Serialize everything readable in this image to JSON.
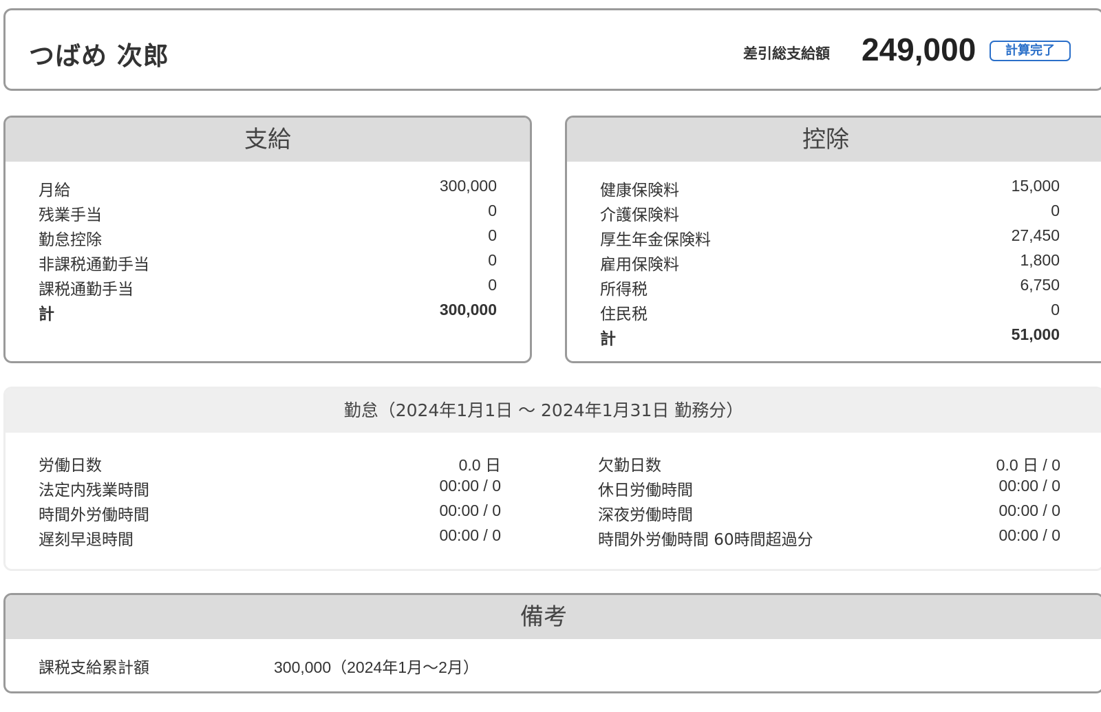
{
  "header": {
    "employee_name": "つばめ 次郎",
    "net_pay_label": "差引総支給額",
    "net_pay_amount": "249,000",
    "status_badge": "計算完了"
  },
  "payments": {
    "title": "支給",
    "items": [
      {
        "label": "月給",
        "value": "300,000"
      },
      {
        "label": "残業手当",
        "value": "0"
      },
      {
        "label": "勤怠控除",
        "value": "0"
      },
      {
        "label": "非課税通勤手当",
        "value": "0"
      },
      {
        "label": "課税通勤手当",
        "value": "0"
      }
    ],
    "total_label": "計",
    "total_value": "300,000"
  },
  "deductions": {
    "title": "控除",
    "items": [
      {
        "label": "健康保険料",
        "value": "15,000"
      },
      {
        "label": "介護保険料",
        "value": "0"
      },
      {
        "label": "厚生年金保険料",
        "value": "27,450"
      },
      {
        "label": "雇用保険料",
        "value": "1,800"
      },
      {
        "label": "所得税",
        "value": "6,750"
      },
      {
        "label": "住民税",
        "value": "0"
      }
    ],
    "total_label": "計",
    "total_value": "51,000"
  },
  "attendance": {
    "title": "勤怠（2024年1月1日 〜 2024年1月31日 勤務分）",
    "left": [
      {
        "label": "労働日数",
        "value": "0.0 日"
      },
      {
        "label": "法定内残業時間",
        "value": "00:00 / 0"
      },
      {
        "label": "時間外労働時間",
        "value": "00:00 / 0"
      },
      {
        "label": "遅刻早退時間",
        "value": "00:00 / 0"
      }
    ],
    "right": [
      {
        "label": "欠勤日数",
        "value": "0.0 日 / 0"
      },
      {
        "label": "休日労働時間",
        "value": "00:00 / 0"
      },
      {
        "label": "深夜労働時間",
        "value": "00:00 / 0"
      },
      {
        "label": "時間外労働時間 60時間超過分",
        "value": "00:00 / 0"
      }
    ]
  },
  "remarks": {
    "title": "備考",
    "label": "課税支給累計額",
    "value": "300,000（2024年1月〜2月）"
  }
}
